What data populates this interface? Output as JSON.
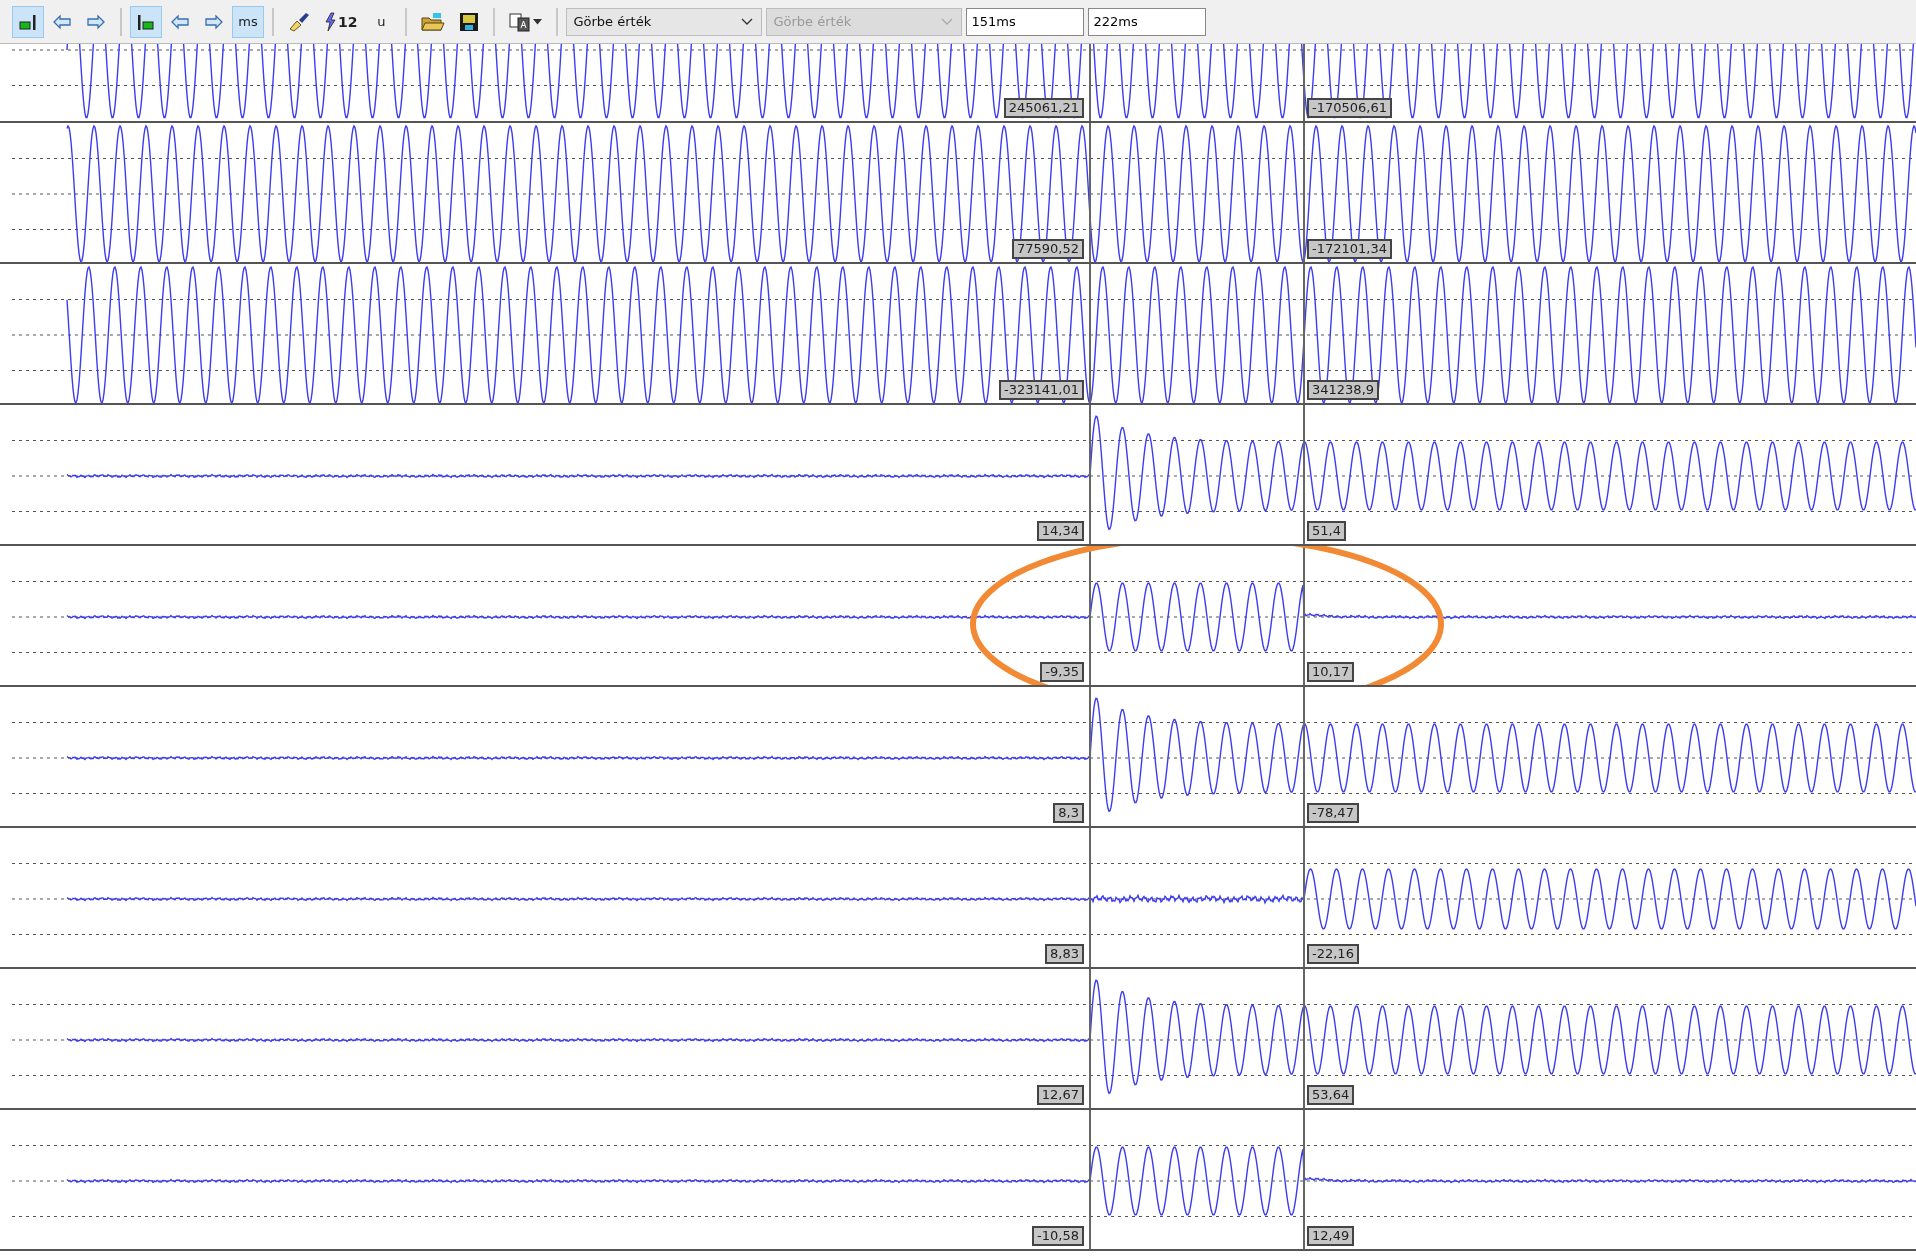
{
  "toolbar": {
    "groups": [
      [
        {
          "kind": "marker-right",
          "selected": true
        },
        {
          "kind": "arrow-left",
          "selected": false
        },
        {
          "kind": "arrow-right",
          "selected": false
        }
      ],
      [
        {
          "kind": "marker-left",
          "selected": true
        },
        {
          "kind": "arrow-left",
          "selected": false
        },
        {
          "kind": "arrow-right",
          "selected": false
        },
        {
          "kind": "text",
          "label": "ms",
          "selected": true
        }
      ],
      [
        {
          "kind": "brush",
          "selected": false
        },
        {
          "kind": "lightning",
          "label": "12",
          "selected": false
        },
        {
          "kind": "text",
          "label": "u",
          "selected": false
        }
      ],
      [
        {
          "kind": "open",
          "selected": false
        },
        {
          "kind": "save",
          "selected": false
        }
      ],
      [
        {
          "kind": "translate",
          "selected": false
        }
      ]
    ],
    "selects": [
      {
        "value": "Görbe érték",
        "disabled": false
      },
      {
        "value": "Görbe érték",
        "disabled": true
      }
    ],
    "fields": [
      "151ms",
      "222ms"
    ]
  },
  "channels": [
    {
      "kind": "sine",
      "left_value": "245061,21",
      "right_value": "-170506,61",
      "highlighted": false
    },
    {
      "kind": "sine",
      "left_value": "77590,52",
      "right_value": "-172101,34",
      "highlighted": false
    },
    {
      "kind": "sine",
      "left_value": "-323141,01",
      "right_value": "341238,9",
      "highlighted": false
    },
    {
      "kind": "onset",
      "left_value": "14,34",
      "right_value": "51,4",
      "highlighted": false
    },
    {
      "kind": "pulse",
      "left_value": "-9,35",
      "right_value": "10,17",
      "highlighted": true
    },
    {
      "kind": "onset",
      "left_value": "8,3",
      "right_value": "-78,47",
      "highlighted": false
    },
    {
      "kind": "late",
      "left_value": "8,83",
      "right_value": "-22,16",
      "highlighted": false
    },
    {
      "kind": "onset",
      "left_value": "12,67",
      "right_value": "53,64",
      "highlighted": false
    },
    {
      "kind": "pulse",
      "left_value": "-10,58",
      "right_value": "12,49",
      "highlighted": false
    }
  ]
}
